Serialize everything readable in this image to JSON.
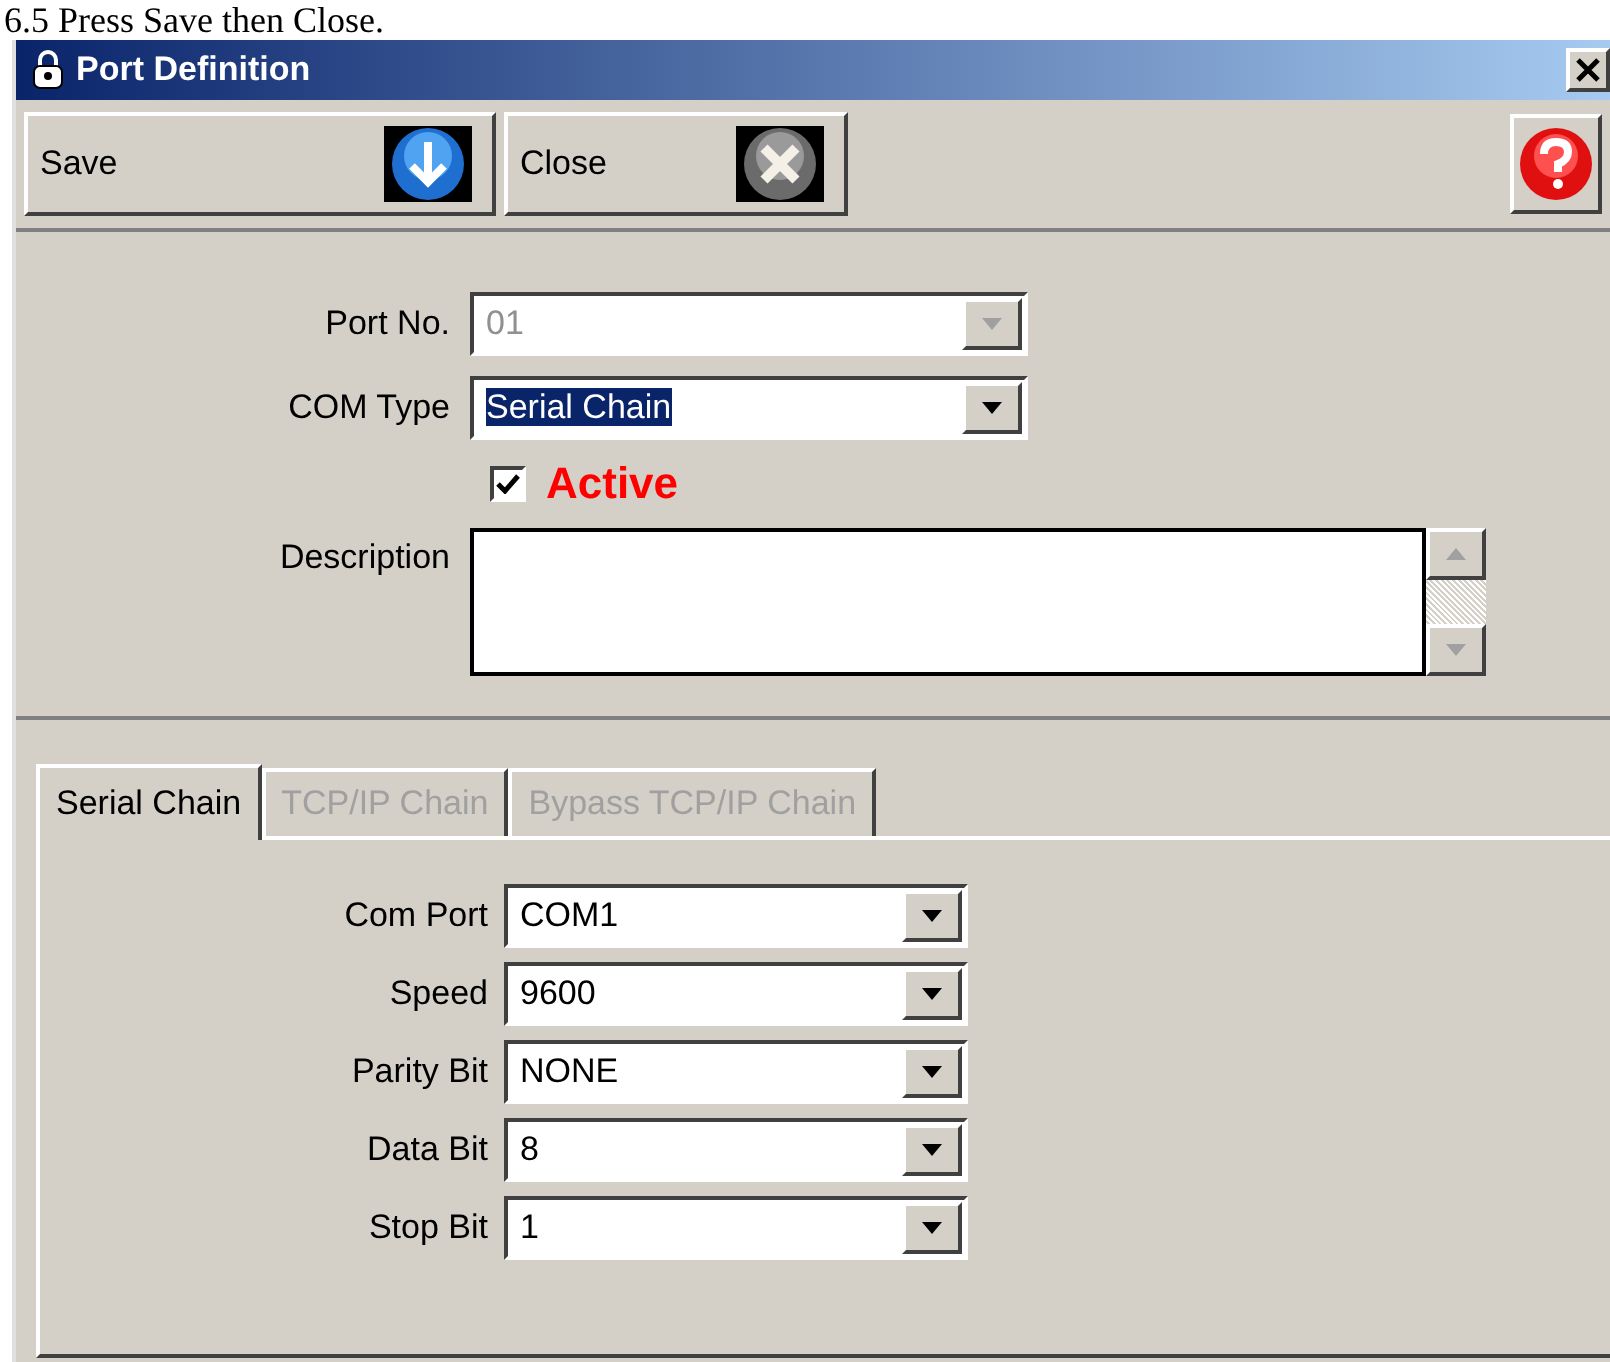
{
  "document_heading": "6.5  Press Save then Close.",
  "window": {
    "title": "Port Definition"
  },
  "toolbar": [
    {
      "label": "Save",
      "kind": "save"
    },
    {
      "label": "Close",
      "kind": "close"
    },
    {
      "kind": "help"
    }
  ],
  "form": [
    {
      "kind": "combo",
      "label": "Port No.",
      "value": "01",
      "disabled": true,
      "highlighted": false
    },
    {
      "kind": "combo",
      "label": "COM Type",
      "value": "Serial Chain",
      "disabled": false,
      "highlighted": true
    },
    {
      "kind": "checkbox",
      "label": "Active",
      "checked": true
    },
    {
      "kind": "memo",
      "label": "Description"
    }
  ],
  "tabs": [
    {
      "label": "Serial Chain",
      "selected": true,
      "disabled": false
    },
    {
      "label": "TCP/IP Chain",
      "selected": false,
      "disabled": true
    },
    {
      "label": "Bypass TCP/IP Chain",
      "selected": false,
      "disabled": true
    }
  ],
  "serial_settings": [
    {
      "label": "Com Port",
      "value": "COM1"
    },
    {
      "label": "Speed",
      "value": "9600"
    },
    {
      "label": "Parity Bit",
      "value": "NONE"
    },
    {
      "label": "Data Bit",
      "value": "8"
    },
    {
      "label": "Stop Bit",
      "value": "1"
    }
  ]
}
